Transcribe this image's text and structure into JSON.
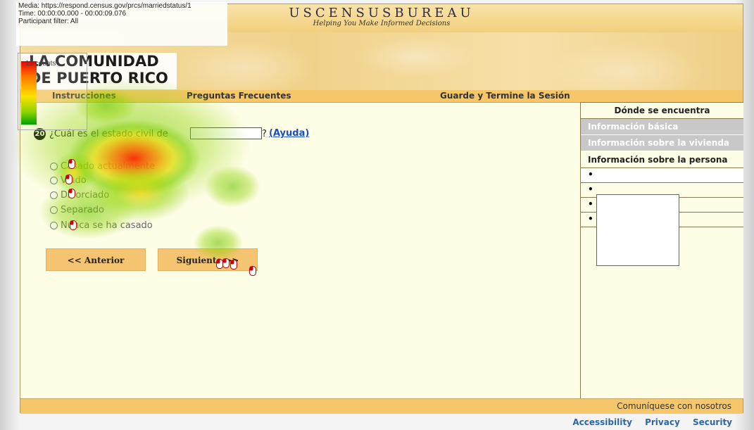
{
  "header": {
    "bureau_title": "USCENSUSBUREAU",
    "tagline": "Helping You Make Informed Decisions",
    "community_line1": "LA COMUNIDAD",
    "community_line2": "DE PUERTO RICO"
  },
  "nav": {
    "instrucciones": "Instrucciones",
    "preguntas": "Preguntas Frecuentes",
    "guarde": "Guarde y Termine la Sesión"
  },
  "overlay": {
    "media": "Media: https://respond.census.gov/prcs/marriedstatus/1",
    "time": "Time: 00:00:00.000 - 00:00:09.076",
    "filter": "Participant filter: All",
    "legend_label": "13 counts",
    "colors": {
      "max": "#e60000",
      "mid": "#ffe000",
      "min": "#00a000"
    }
  },
  "question": {
    "number": "20",
    "text": "¿Cuál es el estado civil de",
    "input_value": "",
    "question_mark": "?",
    "help": "(Ayuda)"
  },
  "options": [
    {
      "label": "Casado actualmente"
    },
    {
      "label": "Viudo"
    },
    {
      "label": "Divorciado"
    },
    {
      "label": "Separado"
    },
    {
      "label": "Nunca se ha casado"
    }
  ],
  "buttons": {
    "prev": "<<  Anterior",
    "next": "Siguiente  >>"
  },
  "sidebar": {
    "header": "Dónde se encuentra",
    "items": [
      {
        "label": "Información básica"
      },
      {
        "label": "Información sobre la vivienda"
      },
      {
        "label": "Información sobre la persona"
      }
    ],
    "bullet": "•"
  },
  "footer": {
    "contact": "Comuníquese con nosotros",
    "links": [
      "Accessibility",
      "Privacy",
      "Security"
    ]
  },
  "colors": {
    "nav_bar": "#f6c76a",
    "page_bg": "#fefde6",
    "link": "#1a4fc0"
  }
}
